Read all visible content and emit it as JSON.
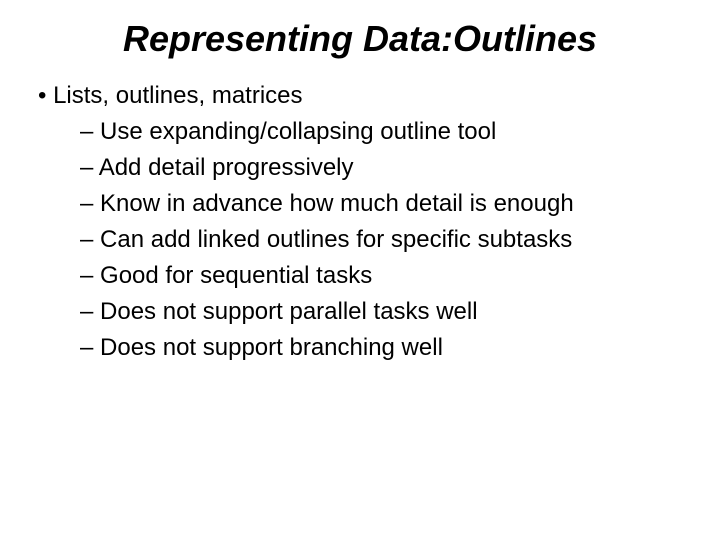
{
  "title": "Representing Data:Outlines",
  "level1": {
    "bullet": "•",
    "text": "Lists, outlines, matrices"
  },
  "level2": {
    "dash": "–",
    "items": [
      "Use expanding/collapsing outline tool",
      "Add detail progressively",
      "Know in advance how much detail is enough",
      "Can add linked outlines for specific subtasks",
      "Good for sequential tasks",
      "Does not support parallel tasks well",
      "Does not support branching well"
    ]
  }
}
